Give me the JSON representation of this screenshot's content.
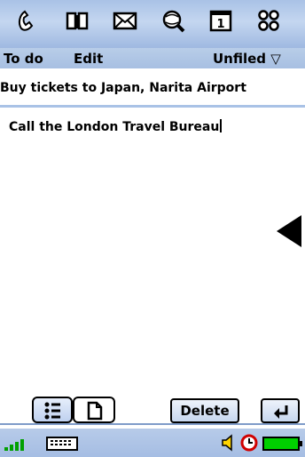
{
  "launcher": {
    "icons": [
      "phone-icon",
      "contacts-book-icon",
      "messages-icon",
      "web-search-icon",
      "calendar-icon",
      "applications-grid-icon"
    ]
  },
  "titlebar": {
    "app_title": "To do",
    "menu_edit": "Edit",
    "category": "Unfiled ▽"
  },
  "task": {
    "title": "Buy tickets to Japan, Narita Airport",
    "note_text": "Call the London Travel Bureau"
  },
  "commands": {
    "delete_label": "Delete"
  },
  "status": {
    "battery_color": "#00d000",
    "alarm_color": "#d00000",
    "signal_color": "#00a000"
  }
}
